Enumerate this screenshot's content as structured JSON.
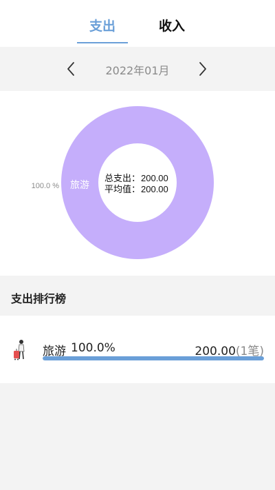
{
  "tabs": {
    "expense_label": "支出",
    "income_label": "收入",
    "active": "expense"
  },
  "month_nav": {
    "current_month": "2022年01月"
  },
  "donut": {
    "center_total_label": "总支出：",
    "center_total_value": "200.00",
    "center_avg_label": "平均值：",
    "center_avg_value": "200.00",
    "slice_label": "旅游",
    "slice_percent_label": "100.0 %",
    "slice_color": "#c5aefb"
  },
  "chart_data": {
    "type": "pie",
    "categories": [
      "旅游"
    ],
    "values": [
      100.0
    ],
    "total": 200.0
  },
  "ranking": {
    "title": "支出排行榜",
    "items": [
      {
        "name": "旅游",
        "percent": "100.0%",
        "amount": "200.00",
        "count": "(1笔)",
        "fill_fraction": 1.0,
        "icon": "travel-luggage-icon"
      }
    ]
  },
  "colors": {
    "accent": "#6a9fd8",
    "slice": "#c5aefb",
    "muted_text": "#8a8a8a"
  }
}
